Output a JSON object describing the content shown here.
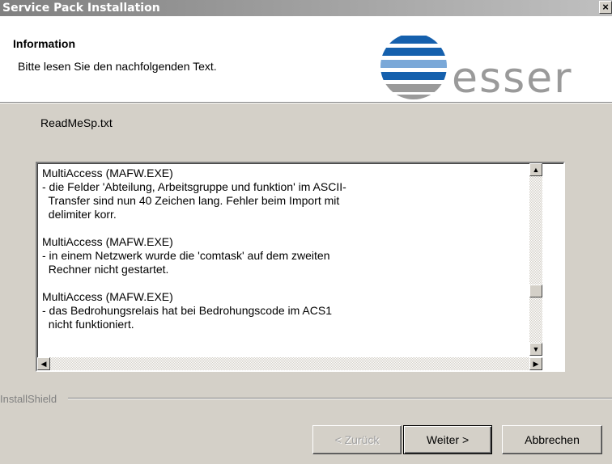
{
  "window": {
    "title": "Service Pack Installation",
    "close_label": "×"
  },
  "header": {
    "title": "Information",
    "subtitle": "Bitte lesen Sie den nachfolgenden Text.",
    "logo_text": "esser",
    "logo_colors": {
      "blue": "#1560ad",
      "light_blue": "#7aa8d8",
      "gray": "#9a9a9a"
    }
  },
  "file_label": "ReadMeSp.txt",
  "readme": {
    "paragraphs": [
      {
        "lines": [
          "MultiAccess (MAFW.EXE)",
          "- die Felder 'Abteilung, Arbeitsgruppe und funktion' im ASCII-",
          "  Transfer sind nun 40 Zeichen lang. Fehler beim Import mit",
          "  delimiter korr."
        ]
      },
      {
        "lines": [
          "MultiAccess (MAFW.EXE)",
          "- in einem Netzwerk wurde die 'comtask' auf dem zweiten",
          "  Rechner nicht gestartet."
        ]
      },
      {
        "lines": [
          "MultiAccess (MAFW.EXE)",
          "- das Bedrohungsrelais hat bei Bedrohungscode im ACS1",
          "  nicht funktioniert."
        ]
      }
    ],
    "scroll_up_icon": "▲",
    "scroll_down_icon": "▼",
    "scroll_left_icon": "◀",
    "scroll_right_icon": "▶"
  },
  "installshield_label": "InstallShield",
  "buttons": {
    "back": "< Zurück",
    "next": "Weiter >",
    "cancel": "Abbrechen"
  }
}
